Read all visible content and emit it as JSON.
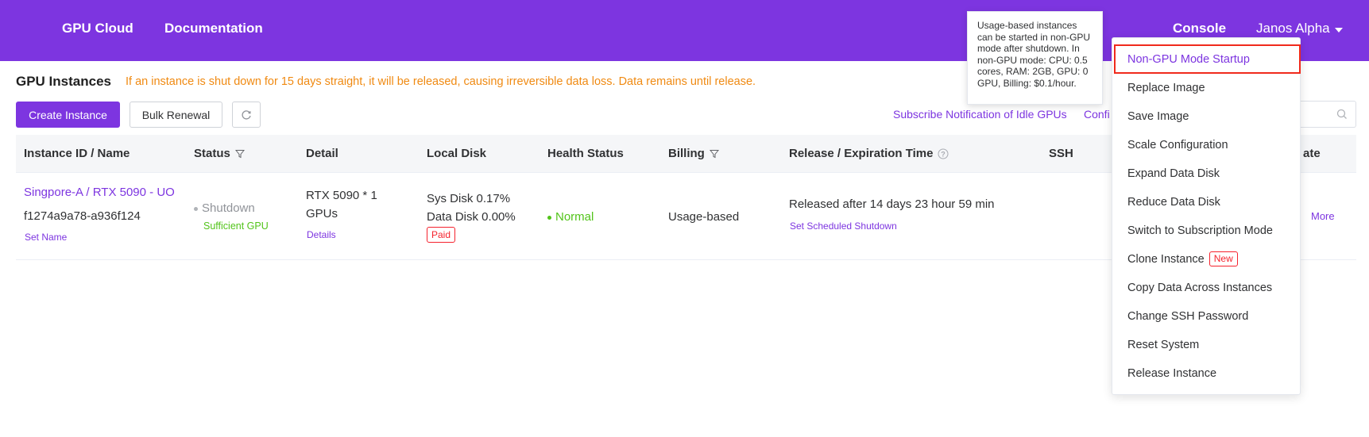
{
  "nav": {
    "gpu_cloud": "GPU Cloud",
    "documentation": "Documentation",
    "console": "Console",
    "user": "Janos Alpha"
  },
  "page": {
    "title": "GPU Instances",
    "warning": "If an instance is shut down for 15 days straight, it will be released, causing irreversible data loss. Data remains until release."
  },
  "toolbar": {
    "create": "Create Instance",
    "bulk_renewal": "Bulk Renewal",
    "subscribe": "Subscribe Notification of Idle GPUs",
    "config": "Confi"
  },
  "table": {
    "headers": {
      "id": "Instance ID / Name",
      "status": "Status",
      "detail": "Detail",
      "disk": "Local Disk",
      "health": "Health Status",
      "billing": "Billing",
      "release": "Release / Expiration Time",
      "ssh": "SSH",
      "operate": "ate"
    },
    "row": {
      "name": "Singpore-A / RTX 5090 - UO",
      "id": "f1274a9a78-a936f124",
      "set_name": "Set Name",
      "status": "Shutdown",
      "status_note": "Sufficient GPU",
      "detail_line1": "RTX 5090 * 1",
      "detail_line2": "GPUs",
      "details_link": "Details",
      "sys_disk": "Sys Disk 0.17%",
      "data_disk": "Data Disk 0.00%",
      "paid": "Paid",
      "health": "Normal",
      "billing": "Usage-based",
      "release": "Released after 14 days 23 hour 59 min",
      "set_shutdown": "Set Scheduled Shutdown",
      "more": "More"
    }
  },
  "tooltip": {
    "text": "Usage-based instances can be started in non-GPU mode after shutdown. In non-GPU mode: CPU: 0.5 cores, RAM: 2GB, GPU: 0 GPU, Billing: $0.1/hour."
  },
  "menu": {
    "items": [
      "Non-GPU Mode Startup",
      "Replace Image",
      "Save Image",
      "Scale Configuration",
      "Expand Data Disk",
      "Reduce Data Disk",
      "Switch to Subscription Mode",
      "Clone Instance",
      "Copy Data Across Instances",
      "Change SSH Password",
      "Reset System",
      "Release Instance"
    ],
    "new_badge": "New"
  },
  "colors": {
    "brand": "#7d35e0",
    "warning": "#f08a12",
    "success": "#52c41a",
    "danger": "#f5222d"
  }
}
